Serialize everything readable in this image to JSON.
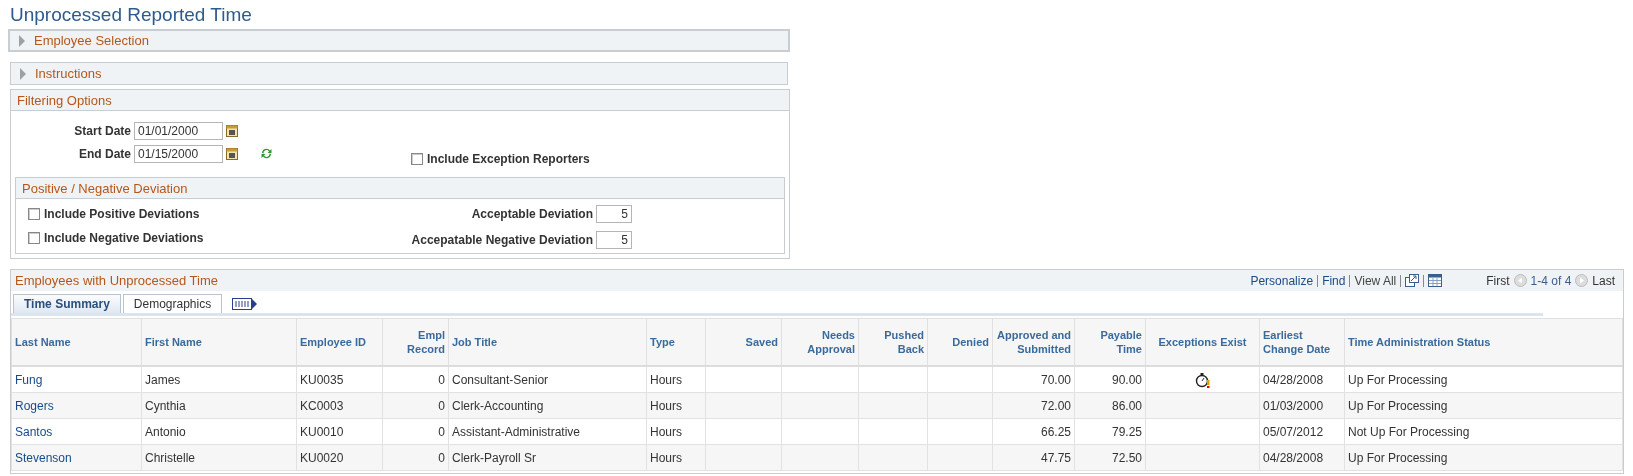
{
  "title": "Unprocessed Reported Time",
  "collapsibles": [
    {
      "label": "Employee Selection",
      "expanded": false
    },
    {
      "label": "Instructions",
      "expanded": false
    }
  ],
  "filtering": {
    "title": "Filtering Options",
    "start_date": {
      "label": "Start Date",
      "value": "01/01/2000"
    },
    "end_date": {
      "label": "End Date",
      "value": "01/15/2000"
    },
    "include_exception_reporters": {
      "label": "Include Exception Reporters",
      "checked": false
    },
    "deviation": {
      "title": "Positive / Negative Deviation",
      "include_positive": {
        "label": "Include Positive Deviations",
        "checked": false
      },
      "include_negative": {
        "label": "Include Negative Deviations",
        "checked": false
      },
      "acceptable_deviation": {
        "label": "Acceptable Deviation",
        "value": "5"
      },
      "negative_deviation": {
        "label": "Accepatable Negative Deviation",
        "value": "5"
      }
    }
  },
  "grid": {
    "title": "Employees with Unprocessed Time",
    "links": [
      "Personalize",
      "Find",
      "View All"
    ],
    "pager": {
      "first": "First",
      "range": "1-4 of 4",
      "last": "Last"
    },
    "tabs": [
      {
        "label": "Time Summary",
        "selected": true
      },
      {
        "label": "Demographics",
        "selected": false
      }
    ],
    "columns": [
      {
        "label": "Last Name",
        "kind": "link"
      },
      {
        "label": "First Name",
        "kind": "text"
      },
      {
        "label": "Employee ID",
        "kind": "text"
      },
      {
        "label": "Empl Record",
        "kind": "number"
      },
      {
        "label": "Job Title",
        "kind": "text"
      },
      {
        "label": "Type",
        "kind": "text"
      },
      {
        "label": "Saved",
        "kind": "number"
      },
      {
        "label": "Needs Approval",
        "kind": "number"
      },
      {
        "label": "Pushed Back",
        "kind": "number"
      },
      {
        "label": "Denied",
        "kind": "number"
      },
      {
        "label": "Approved and Submitted",
        "kind": "number"
      },
      {
        "label": "Payable Time",
        "kind": "number"
      },
      {
        "label": "Exceptions Exist",
        "kind": "icon"
      },
      {
        "label": "Earliest Change Date",
        "kind": "text"
      },
      {
        "label": "Time Administration Status",
        "kind": "text"
      }
    ],
    "rows": [
      {
        "cells": [
          "Fung",
          "James",
          "KU0035",
          "0",
          "Consultant-Senior",
          "Hours",
          null,
          null,
          null,
          null,
          "70.00",
          "90.00",
          true,
          "04/28/2008",
          "Up For Processing"
        ]
      },
      {
        "cells": [
          "Rogers",
          "Cynthia",
          "KC0003",
          "0",
          "Clerk-Accounting",
          "Hours",
          null,
          null,
          null,
          null,
          "72.00",
          "86.00",
          false,
          "01/03/2000",
          "Up For Processing"
        ]
      },
      {
        "cells": [
          "Santos",
          "Antonio",
          "KU0010",
          "0",
          "Assistant-Administrative",
          "Hours",
          null,
          null,
          null,
          null,
          "66.25",
          "79.25",
          false,
          "05/07/2012",
          "Not Up For Processing"
        ]
      },
      {
        "cells": [
          "Stevenson",
          "Christelle",
          "KU0020",
          "0",
          "Clerk-Payroll Sr",
          "Hours",
          null,
          null,
          null,
          null,
          "47.75",
          "72.50",
          false,
          "04/28/2008",
          "Up For Processing"
        ]
      }
    ]
  }
}
